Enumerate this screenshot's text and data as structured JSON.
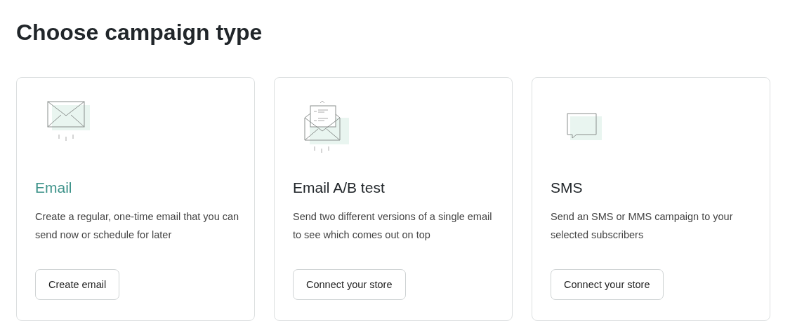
{
  "heading": "Choose campaign type",
  "cards": [
    {
      "kind": "email",
      "title": "Email",
      "selected": true,
      "description": "Create a regular, one-time email that you can send now or schedule for later",
      "button": "Create email"
    },
    {
      "kind": "ab_test",
      "title": "Email A/B test",
      "selected": false,
      "description": "Send two different versions of a single email to see which comes out on top",
      "button": "Connect your store"
    },
    {
      "kind": "sms",
      "title": "SMS",
      "selected": false,
      "description": "Send an SMS or MMS campaign to your selected subscribers",
      "button": "Connect your store"
    }
  ]
}
